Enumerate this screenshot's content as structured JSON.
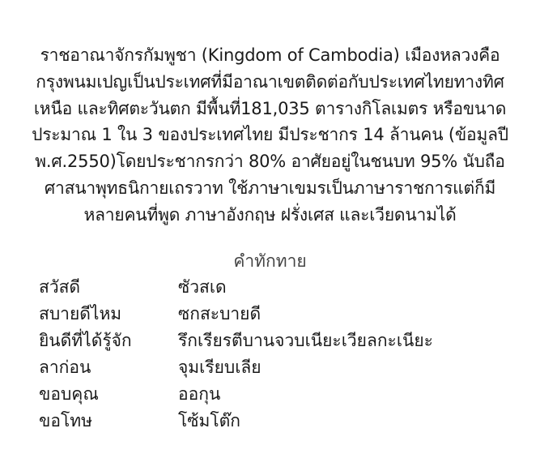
{
  "paragraph_lines": [
    "ราชอาณาจักรกัมพูชา (Kingdom of Cambodia) เมืองหลวงคือ",
    "กรุงพนมเปญเป็นประเทศที่มีอาณาเขตติดต่อกับประเทศไทยทางทิศ",
    "เหนือ และทิศตะวันตก มีพื้นที่181,035 ตารางกิโลเมตร หรือขนาด",
    "ประมาณ 1 ใน 3 ของประเทศไทย มีประชากร 14 ล้านคน (ข้อมูลปี",
    "พ.ศ.2550)โดยประชากรกว่า 80% อาศัยอยู่ในชนบท 95% นับถือ",
    "ศาสนาพุทธนิกายเถรวาท ใช้ภาษาเขมรเป็นภาษาราชการแต่ก็มี",
    "หลายคนที่พูด ภาษาอังกฤษ ฝรั่งเศส และเวียดนามได้"
  ],
  "greetings": {
    "title": "คำทักทาย",
    "rows": [
      {
        "thai": "สวัสดี",
        "khmer": "ซัวสเด"
      },
      {
        "thai": "สบายดีไหม",
        "khmer": "ซกสะบายดี"
      },
      {
        "thai": "ยินดีที่ได้รู้จัก",
        "khmer": "รึกเรียรตีบานจวบเนียะเวียลกะเนียะ"
      },
      {
        "thai": "ลาก่อน",
        "khmer": "จุมเรียบเลีย"
      },
      {
        "thai": "ขอบคุณ",
        "khmer": "ออกุน"
      },
      {
        "thai": "ขอโทษ",
        "khmer": "โซ้มโต๊ก"
      }
    ]
  }
}
